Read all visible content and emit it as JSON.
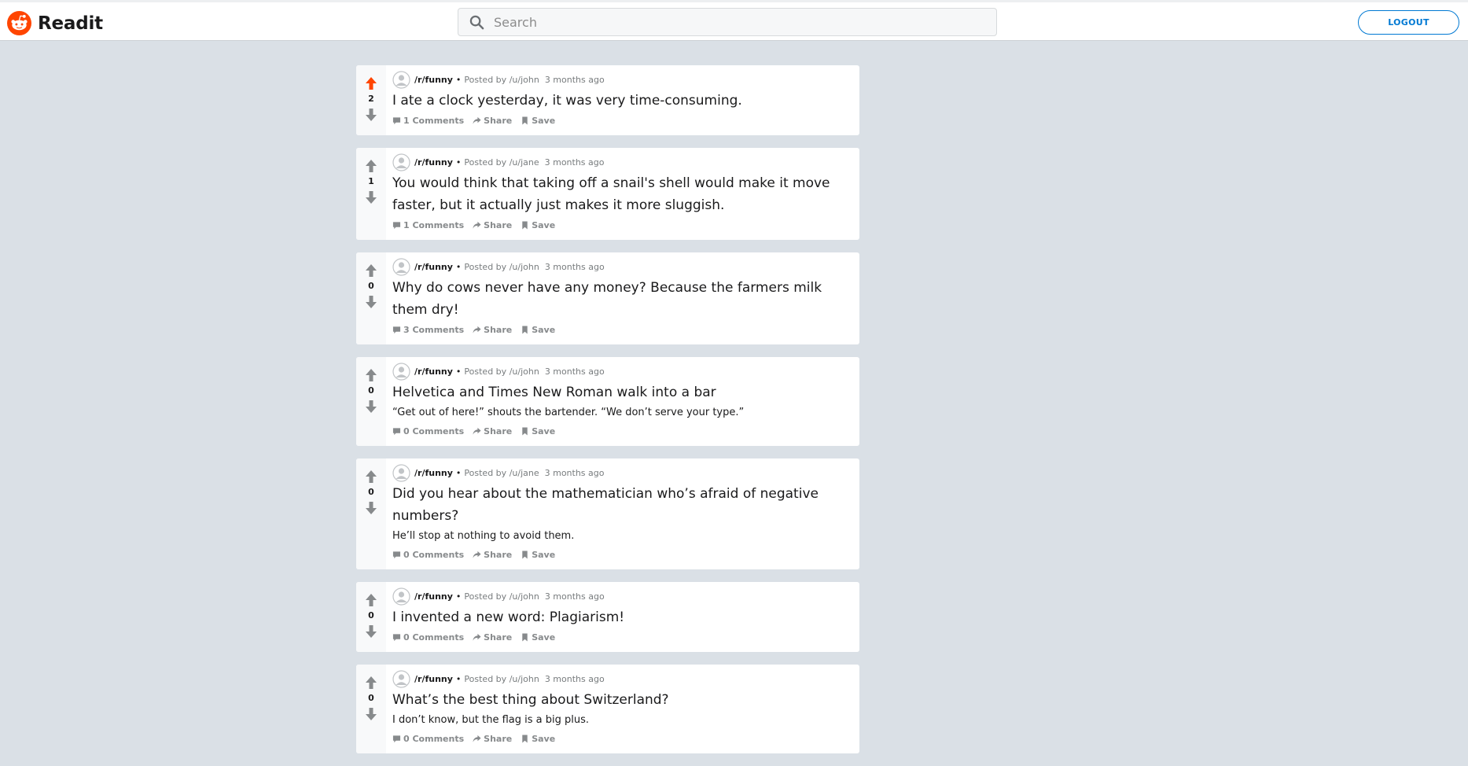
{
  "app": {
    "name": "Readit",
    "brand_color": "#ff4500"
  },
  "search": {
    "placeholder": "Search"
  },
  "header": {
    "logout_label": "LOGOUT"
  },
  "colors": {
    "accent": "#0079d3",
    "upvote_active": "#ff4500",
    "vote_idle": "#878a8c",
    "background": "#dae0e6"
  },
  "labels": {
    "posted_by": "Posted by",
    "share": "Share",
    "save": "Save",
    "separator": "•"
  },
  "posts": [
    {
      "subreddit": "/r/funny",
      "author": "/u/john",
      "time": "3 months ago",
      "score": "2",
      "upvoted": true,
      "title": "I ate a clock yesterday, it was very time-consuming.",
      "body": "",
      "comments": "1 Comments"
    },
    {
      "subreddit": "/r/funny",
      "author": "/u/jane",
      "time": "3 months ago",
      "score": "1",
      "upvoted": false,
      "title": "You would think that taking off a snail's shell would make it move faster, but it actually just makes it more sluggish.",
      "body": "",
      "comments": "1 Comments"
    },
    {
      "subreddit": "/r/funny",
      "author": "/u/john",
      "time": "3 months ago",
      "score": "0",
      "upvoted": false,
      "title": "Why do cows never have any money? Because the farmers milk them dry!",
      "body": "",
      "comments": "3 Comments"
    },
    {
      "subreddit": "/r/funny",
      "author": "/u/john",
      "time": "3 months ago",
      "score": "0",
      "upvoted": false,
      "title": "Helvetica and Times New Roman walk into a bar",
      "body": "“Get out of here!” shouts the bartender. “We don’t serve your type.”",
      "comments": "0 Comments"
    },
    {
      "subreddit": "/r/funny",
      "author": "/u/jane",
      "time": "3 months ago",
      "score": "0",
      "upvoted": false,
      "title": "Did you hear about the mathematician who’s afraid of negative numbers?",
      "body": "He’ll stop at nothing to avoid them.",
      "comments": "0 Comments"
    },
    {
      "subreddit": "/r/funny",
      "author": "/u/john",
      "time": "3 months ago",
      "score": "0",
      "upvoted": false,
      "title": "I invented a new word: Plagiarism!",
      "body": "",
      "comments": "0 Comments"
    },
    {
      "subreddit": "/r/funny",
      "author": "/u/john",
      "time": "3 months ago",
      "score": "0",
      "upvoted": false,
      "title": "What’s the best thing about Switzerland?",
      "body": "I don’t know, but the flag is a big plus.",
      "comments": "0 Comments"
    }
  ]
}
